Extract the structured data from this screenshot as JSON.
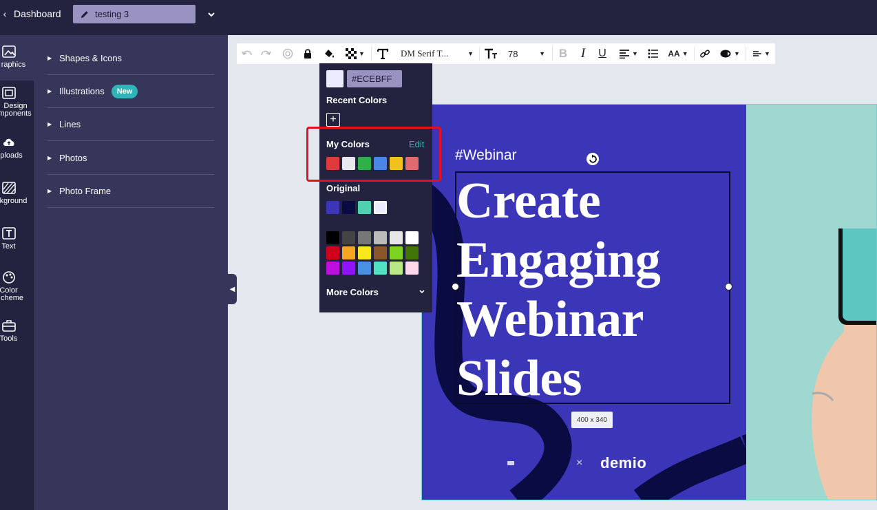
{
  "topbar": {
    "back_label": "Dashboard",
    "doc_name": "testing 3"
  },
  "rail": {
    "items": [
      {
        "label": "Graphics",
        "icon": "image-icon"
      },
      {
        "label": "Design Components",
        "icon": "components-icon"
      },
      {
        "label": "Uploads",
        "icon": "cloud-upload-icon"
      },
      {
        "label": "Background",
        "icon": "background-icon"
      },
      {
        "label": "Text",
        "icon": "text-icon"
      },
      {
        "label": "Color Scheme",
        "icon": "palette-icon"
      },
      {
        "label": "Tools",
        "icon": "toolbox-icon"
      }
    ],
    "visible_labels": [
      "raphics",
      "Design",
      "mponents",
      "ploads",
      "kground",
      "Text",
      "Color",
      "cheme",
      "Tools"
    ]
  },
  "panel": {
    "sections": [
      {
        "label": "Shapes & Icons"
      },
      {
        "label": "Illustrations",
        "badge": "New"
      },
      {
        "label": "Lines"
      },
      {
        "label": "Photos"
      },
      {
        "label": "Photo Frame"
      }
    ]
  },
  "toolbar": {
    "font_name": "DM Serif T...",
    "font_size": "78",
    "bold": "B",
    "italic": "I",
    "underline": "U",
    "case_label": "AA"
  },
  "picker": {
    "hex_value": "#ECEBFF",
    "recent_title": "Recent Colors",
    "my_colors_title": "My Colors",
    "edit_label": "Edit",
    "original_title": "Original",
    "more_colors_label": "More Colors",
    "my_colors": [
      "#e03a3e",
      "#e8e8ee",
      "#2fb04a",
      "#4a86e8",
      "#f1c21b",
      "#e06a6f"
    ],
    "original_colors": [
      "#3a36b7",
      "#0b0b44",
      "#4fd1b0",
      "#ECEBFF"
    ],
    "palette": [
      [
        "#000000",
        "#444444",
        "#777777",
        "#bbbbbb",
        "#e6e6e6",
        "#ffffff"
      ],
      [
        "#d0021b",
        "#f5a623",
        "#f8e71c",
        "#8b572a",
        "#7ed321",
        "#417505"
      ],
      [
        "#bd10e0",
        "#9013fe",
        "#4a90e2",
        "#50e3c2",
        "#b8e986",
        "#ffd6ea"
      ]
    ]
  },
  "canvas": {
    "hashtag": "#Webinar",
    "headline_lines": [
      "Create",
      "Engaging",
      "Webinar",
      "Slides"
    ],
    "size_tip": "400 x 340",
    "brand_name": "demio",
    "brand_sep": "×"
  },
  "colors": {
    "topbar_bg": "#232340",
    "panel_bg": "#36355a",
    "accent": "#2fb4b7",
    "design_bg": "#3a36b7",
    "highlight": "#e3101d"
  }
}
